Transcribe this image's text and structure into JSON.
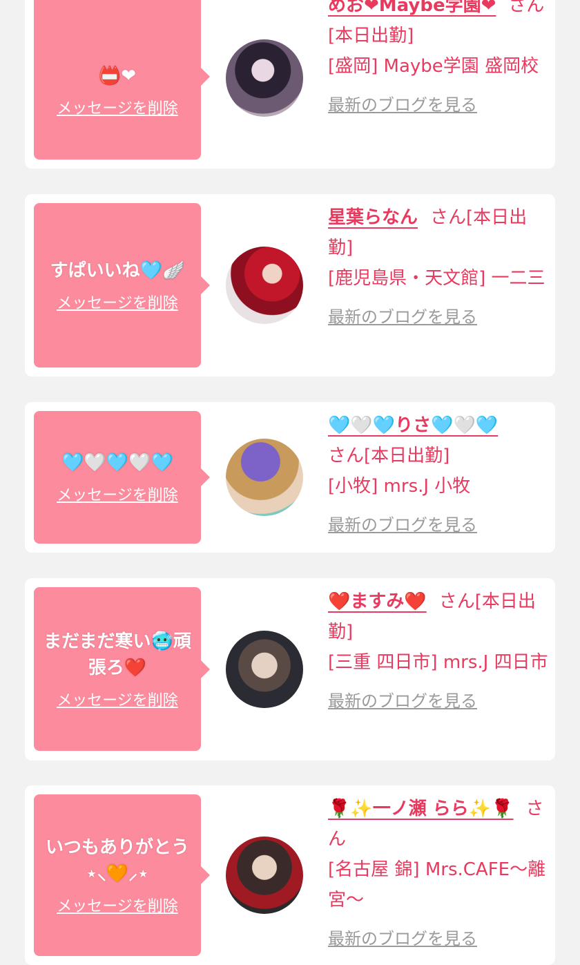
{
  "cards": [
    {
      "message": "📛❤",
      "delete_label": "メッセージを削除",
      "name": "めお❤Maybe学園❤",
      "suffix": "さん[本日出勤]",
      "shop": "[盛岡] Maybe学園 盛岡校",
      "blog_label": "最新のブログを見る"
    },
    {
      "message": "すぱいいね🩵🪽",
      "delete_label": "メッセージを削除",
      "name": "星葉らなん",
      "suffix": "さん[本日出勤]",
      "shop": "[鹿児島県・天文館] 一二三",
      "blog_label": "最新のブログを見る"
    },
    {
      "message": "🩵🤍🩵🤍🩵",
      "delete_label": "メッセージを削除",
      "name": "🩵🤍🩵りさ🩵🤍🩵",
      "suffix": "さん[本日出勤]",
      "shop": "[小牧] mrs.J 小牧",
      "blog_label": "最新のブログを見る"
    },
    {
      "message": "まだまだ寒い🥶頑張ろ❤️",
      "delete_label": "メッセージを削除",
      "name": "❤️ますみ❤️",
      "suffix": "さん[本日出勤]",
      "shop": "[三重 四日市] mrs.J 四日市",
      "blog_label": "最新のブログを見る"
    },
    {
      "message": "いつもありがとう⋆⸜🧡⸝‍⋆",
      "delete_label": "メッセージを削除",
      "name": "🌹✨一ノ瀬 らら✨🌹",
      "suffix": "さん",
      "shop": "[名古屋 錦] Mrs.CAFE〜離宮〜",
      "blog_label": "最新のブログを見る"
    }
  ],
  "colors": {
    "bubble": "#fb8b9d",
    "name_text": "#e83a5f",
    "link_gray": "#9a9a9a",
    "page_bg": "#f2f2f2"
  }
}
